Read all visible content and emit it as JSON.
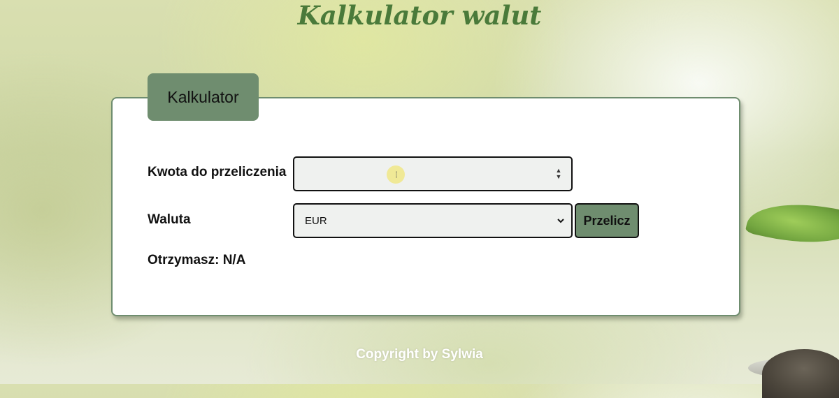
{
  "header": {
    "title": "Kalkulator walut"
  },
  "card": {
    "tab_label": "Kalkulator",
    "amount_label": "Kwota do przeliczenia",
    "amount_value": "",
    "currency_label": "Waluta",
    "currency_selected": "EUR",
    "convert_button_label": "Przelicz",
    "result_text": "Otrzymasz: N/A"
  },
  "footer": {
    "copyright": "Copyright by Sylwia"
  },
  "colors": {
    "accent": "#6f8d6f",
    "title": "#4a7a3a",
    "input_bg": "#eff1ef"
  },
  "icons": {
    "spinner": "number-spinner-icon",
    "select": "chevron-down-icon",
    "cursor": "text-cursor-icon"
  }
}
